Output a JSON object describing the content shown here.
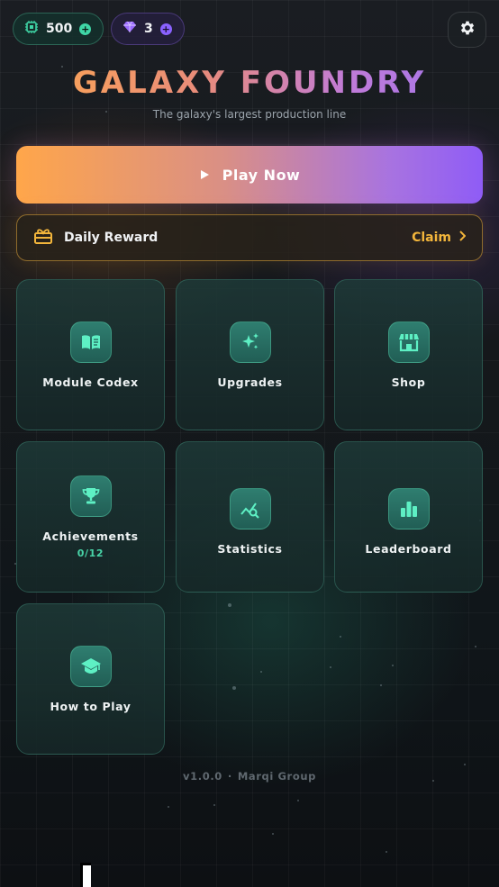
{
  "currency": {
    "chips": {
      "value": "500",
      "icon": "chip-icon",
      "plus_label": "+"
    },
    "gems": {
      "value": "3",
      "icon": "gem-icon",
      "plus_label": "+"
    }
  },
  "header": {
    "title": "GALAXY FOUNDRY",
    "subtitle": "The galaxy's largest production line"
  },
  "play": {
    "label": "Play Now",
    "icon": "play-icon"
  },
  "daily_reward": {
    "label": "Daily Reward",
    "action": "Claim",
    "icon": "gift-icon"
  },
  "menu": {
    "module_codex": {
      "label": "Module Codex",
      "icon": "book-icon"
    },
    "upgrades": {
      "label": "Upgrades",
      "icon": "sparkles-icon"
    },
    "shop": {
      "label": "Shop",
      "icon": "store-icon"
    },
    "achievements": {
      "label": "Achievements",
      "progress": "0/12",
      "icon": "trophy-icon"
    },
    "statistics": {
      "label": "Statistics",
      "icon": "chart-search-icon"
    },
    "leaderboard": {
      "label": "Leaderboard",
      "icon": "podium-icon"
    },
    "how_to_play": {
      "label": "How to Play",
      "icon": "graduation-cap-icon"
    }
  },
  "footer": {
    "version": "v1.0.0",
    "separator": "·",
    "company": "Marqi Group"
  },
  "colors": {
    "accent_teal": "#48d4a8",
    "accent_orange": "#ffa64a",
    "accent_purple": "#8f5cf6",
    "reward_gold": "#f2b53b"
  }
}
